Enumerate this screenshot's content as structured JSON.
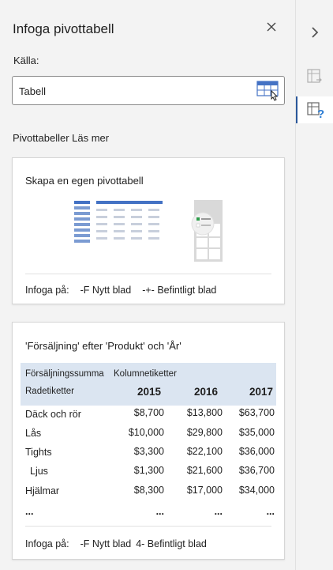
{
  "pane": {
    "title": "Infoga pivottabell",
    "source_label": "Källa:",
    "source_value": "Tabell",
    "section_title": "Pivottabeller Läs mer"
  },
  "custom_card": {
    "title": "Skapa en egen pivottabell",
    "insert_label": "Infoga på:",
    "option_new": "-F Nytt blad",
    "option_existing": "-+- Befintligt blad"
  },
  "pivot_card": {
    "title": "'Försäljning' efter 'Produkt' och 'År'",
    "values_label": "Försäljningssumma",
    "column_label": "Kolumnetiketter",
    "row_label": "Radetiketter",
    "years": [
      "2015",
      "2016",
      "2017"
    ],
    "rows": [
      {
        "label": "Däck och rör",
        "values": [
          "$8,700",
          "$13,800",
          "$63,700"
        ]
      },
      {
        "label": "Lås",
        "values": [
          "$10,000",
          "$29,800",
          "$35,000"
        ]
      },
      {
        "label": "Tights",
        "values": [
          "$3,300",
          "$22,100",
          "$36,000"
        ]
      },
      {
        "label": "Ljus",
        "values": [
          "$1,300",
          "$21,600",
          "$36,700"
        ]
      },
      {
        "label": "Hjälmar",
        "values": [
          "$8,300",
          "$17,000",
          "$34,000"
        ]
      }
    ],
    "ellipsis": "...",
    "insert_label": "Infoga på:",
    "option_new": "-F Nytt blad",
    "option_existing": "4- Befintligt blad"
  },
  "icons": {
    "close": "close-icon",
    "range_select": "table-select-icon",
    "collapse": "chevron-right-icon",
    "pivot_suggestions": "pivot-table-icon",
    "pivot_help": "pivot-help-icon"
  },
  "colors": {
    "accent_blue": "#4472c4",
    "header_fill": "#dbe5f1",
    "pane_bg": "#f3f3f3"
  }
}
